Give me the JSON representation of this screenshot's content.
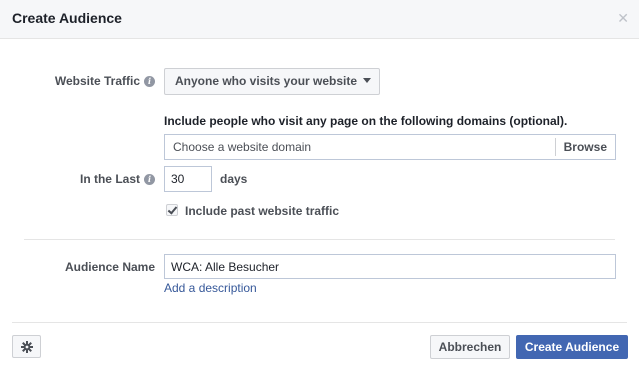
{
  "dialog": {
    "title": "Create Audience",
    "close_icon": "close-icon"
  },
  "form": {
    "website_traffic": {
      "label": "Website Traffic",
      "selected": "Anyone who visits your website"
    },
    "include_domains": {
      "text": "Include people who visit any page on the following domains (optional).",
      "placeholder": "Choose a website domain",
      "browse_label": "Browse"
    },
    "in_the_last": {
      "label": "In the Last",
      "value": "30",
      "unit": "days"
    },
    "include_past": {
      "label": "Include past website traffic",
      "checked": true
    },
    "audience_name": {
      "label": "Audience Name",
      "value": "WCA: Alle Besucher",
      "add_description": "Add a description"
    }
  },
  "footer": {
    "settings_icon": "gear-icon",
    "cancel_label": "Abbrechen",
    "create_label": "Create Audience"
  },
  "colors": {
    "primary": "#4267b2",
    "link": "#365899",
    "header_bg": "#f6f7f9"
  }
}
